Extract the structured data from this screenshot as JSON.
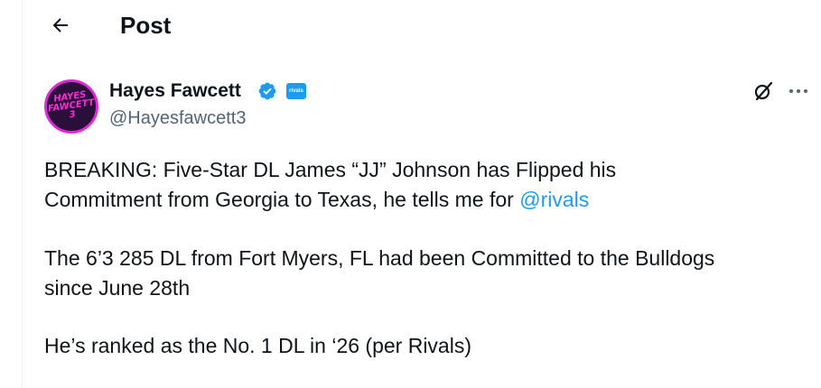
{
  "header": {
    "title": "Post"
  },
  "author": {
    "display_name": "Hayes Fawcett",
    "handle": "@Hayesfawcett3",
    "avatar_text": [
      "HAYES",
      "FAWCETT",
      "3"
    ],
    "affiliate_badge": "rivals"
  },
  "post": {
    "line1": "BREAKING: Five-Star DL James “JJ” Johnson has Flipped his",
    "line2_text": "Commitment from Georgia to Texas, he tells me for ",
    "mention": "@rivals",
    "para2_line1": "The 6’3 285 DL from Fort Myers, FL had been Committed to the Bulldogs",
    "para2_line2": "since June 28th",
    "para3": "He’s ranked as the No. 1 DL in ‘26 (per Rivals)"
  },
  "colors": {
    "accent": "#1d9bf0",
    "text": "#0f1419",
    "secondary": "#536471"
  },
  "icons": {
    "back": "arrow-left-icon",
    "verified": "verified-badge-icon",
    "grok": "grok-icon",
    "more": "more-horizontal-icon"
  }
}
